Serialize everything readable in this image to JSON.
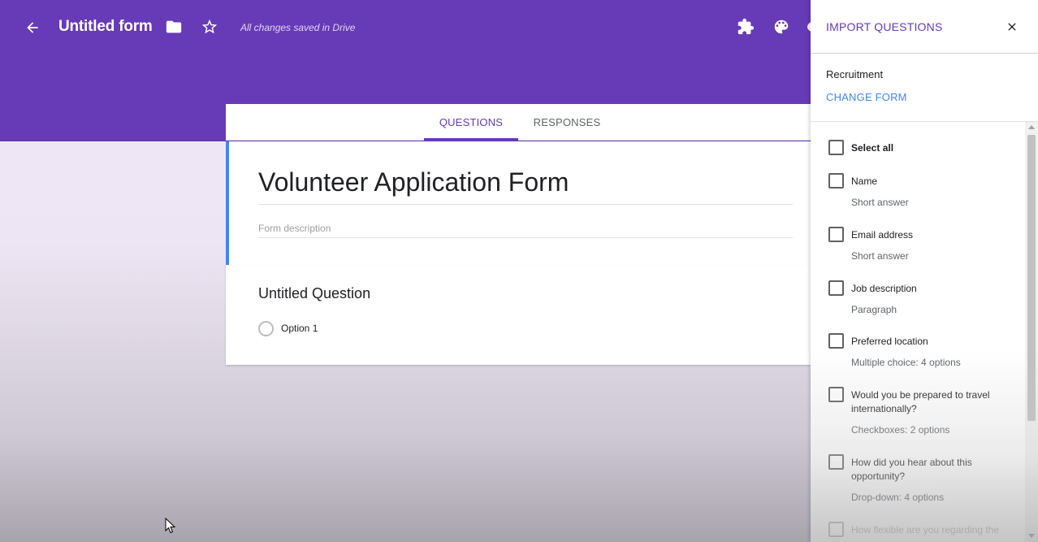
{
  "topbar": {
    "form_title": "Untitled form",
    "saved_status": "All changes saved in Drive",
    "color": "#673ab7"
  },
  "tabs": [
    {
      "label": "QUESTIONS",
      "active": true
    },
    {
      "label": "RESPONSES",
      "active": false
    }
  ],
  "form": {
    "heading": "Volunteer Application Form",
    "description_placeholder": "Form description",
    "question": {
      "title": "Untitled Question",
      "option_label": "Option 1"
    }
  },
  "panel": {
    "title": "IMPORT QUESTIONS",
    "source_form": "Recruitment",
    "change_form_label": "CHANGE FORM",
    "select_all_label": "Select all",
    "questions": [
      {
        "name": "Name",
        "type": "Short answer"
      },
      {
        "name": "Email address",
        "type": "Short answer"
      },
      {
        "name": "Job description",
        "type": "Paragraph"
      },
      {
        "name": "Preferred location",
        "type": "Multiple choice: 4 options"
      },
      {
        "name": "Would you be prepared to travel internationally?",
        "type": "Checkboxes: 2 options"
      },
      {
        "name": "How did you hear about this opportunity?",
        "type": "Drop-down: 4 options"
      },
      {
        "name": "How flexible are you regarding the"
      }
    ]
  },
  "icons": [
    "back-arrow-icon",
    "folder-icon",
    "star-icon",
    "puzzle-icon",
    "palette-icon",
    "close-icon",
    "mouse-cursor-icon"
  ]
}
